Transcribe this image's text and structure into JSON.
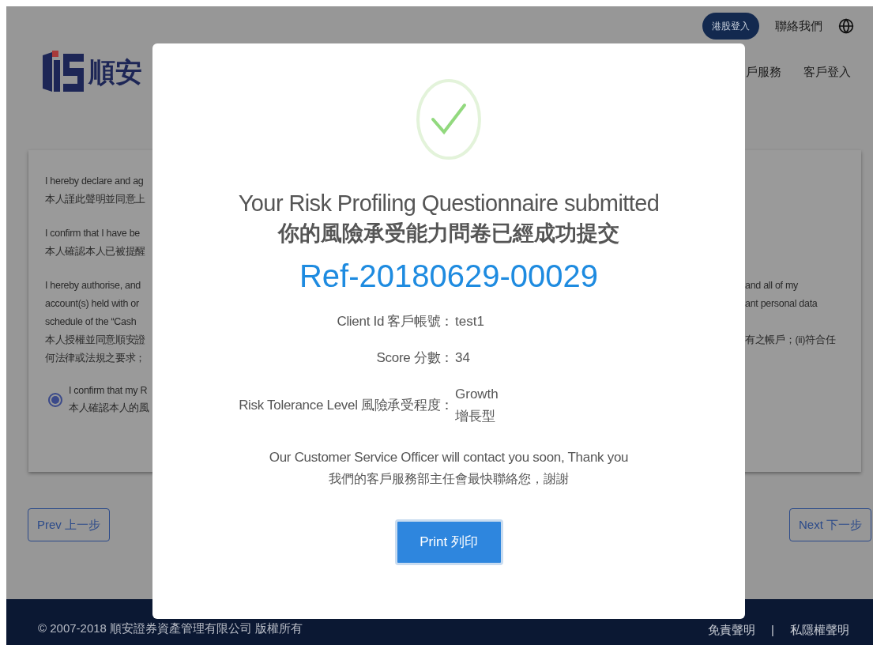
{
  "header": {
    "login_button": "港股登入",
    "contact_link": "聯絡我們",
    "logo_text": "順安",
    "nav": [
      "戶服務",
      "客戶登入"
    ]
  },
  "declaration": {
    "paragraphs": [
      {
        "lines": [
          {
            "left": "I hereby declare and ag"
          },
          {
            "left": "本人謹此聲明並同意上"
          }
        ]
      },
      {
        "lines": [
          {
            "left": "I confirm that I have be"
          },
          {
            "left": "本人確認本人已被提醒"
          }
        ]
      },
      {
        "lines": [
          {
            "left": "I hereby authorise, and",
            "right": "and all of my"
          },
          {
            "left": "account(s) held with or",
            "right": "ant personal data"
          },
          {
            "left": "schedule of the “Cash"
          },
          {
            "left": "本人授權並同意順安證",
            "right": "有之帳戶；(ii)符合任"
          },
          {
            "left": "何法律或法規之要求；"
          }
        ]
      }
    ],
    "radio": {
      "selected": true,
      "lines": [
        "I confirm that my R",
        "本人確認本人的風"
      ]
    }
  },
  "nav_buttons": {
    "prev": "Prev 上一步",
    "next": "Next 下一步"
  },
  "footer": {
    "copyright": "© 2007-2018 順安證券資產管理有限公司 版權所有",
    "separator": "|",
    "links": [
      "免責聲明",
      "私隱權聲明"
    ]
  },
  "dialog": {
    "title": "Your Risk Profiling Questionnaire submitted",
    "title_zh": "你的風險承受能力問卷已經成功提交",
    "reference": "Ref-20180629-00029",
    "fields": [
      {
        "label": "Client Id 客戶帳號：",
        "values": [
          "test1"
        ]
      },
      {
        "label": "Score 分數：",
        "values": [
          "34"
        ]
      },
      {
        "label": "Risk Tolerance Level 風險承受程度：",
        "values": [
          "Growth",
          "增長型"
        ]
      }
    ],
    "message": "Our Customer Service Officer will contact you soon, Thank you",
    "message_zh": "我們的客戶服務部主任會最快聯絡您，謝謝",
    "print_button": "Print 列印"
  }
}
